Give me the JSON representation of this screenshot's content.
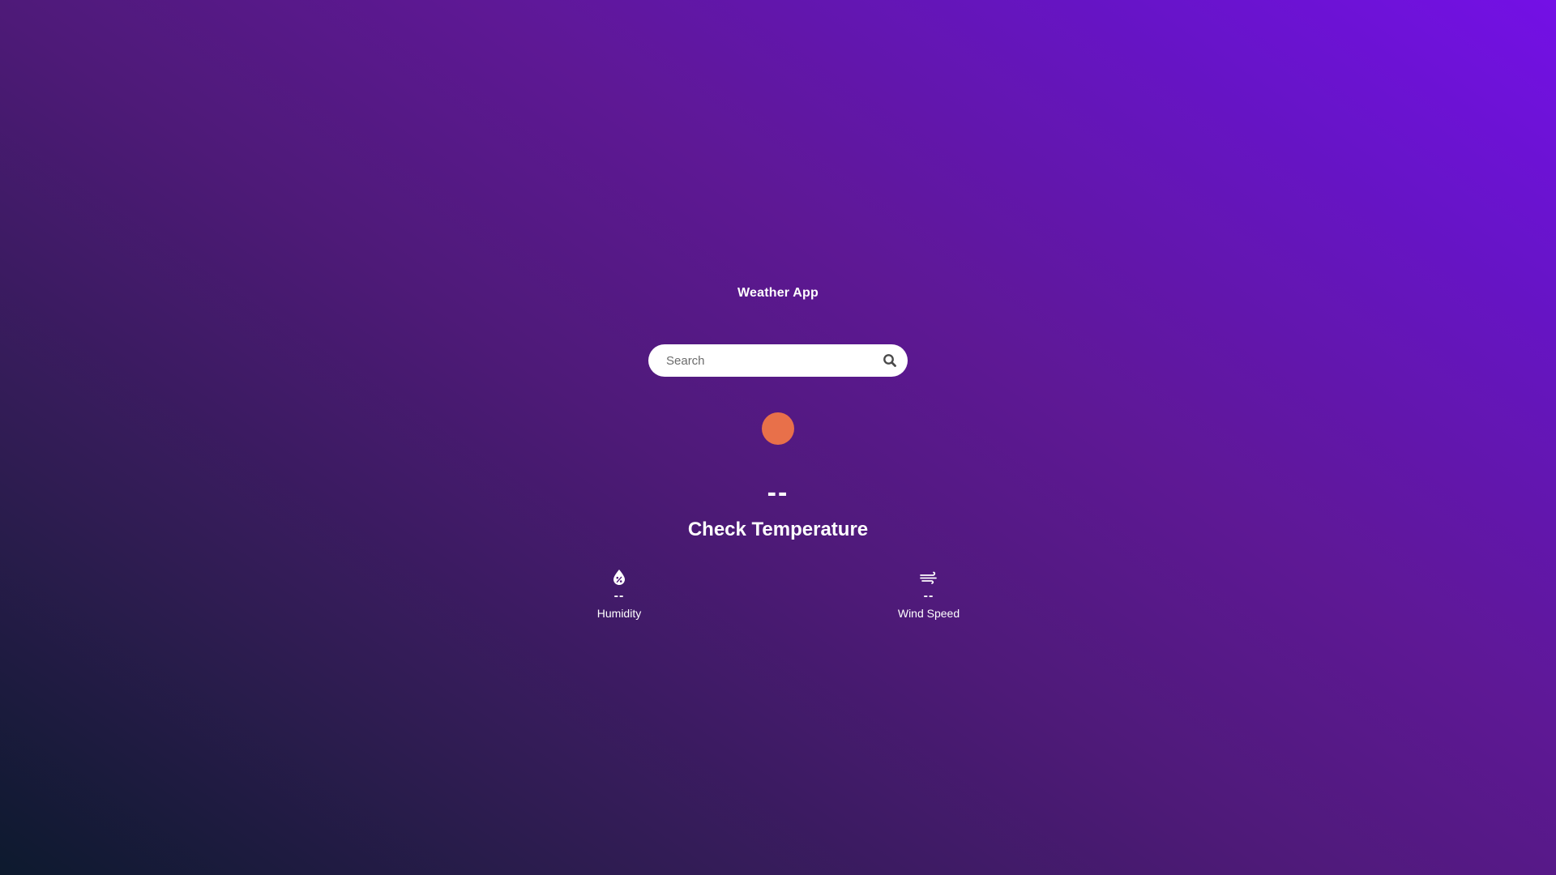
{
  "app": {
    "title": "Weather App"
  },
  "search": {
    "placeholder": "Search",
    "value": "",
    "icon": "search-icon"
  },
  "weather": {
    "condition_icon": "sun-icon",
    "condition_icon_color": "#e8704a",
    "temperature": "--",
    "description": "Check Temperature"
  },
  "stats": {
    "humidity": {
      "icon": "humidity-icon",
      "value": "--",
      "label": "Humidity"
    },
    "wind": {
      "icon": "wind-icon",
      "value": "--",
      "label": "Wind Speed"
    }
  },
  "colors": {
    "background_start": "#0d1a2e",
    "background_end": "#7410e6",
    "accent": "#e8704a"
  }
}
